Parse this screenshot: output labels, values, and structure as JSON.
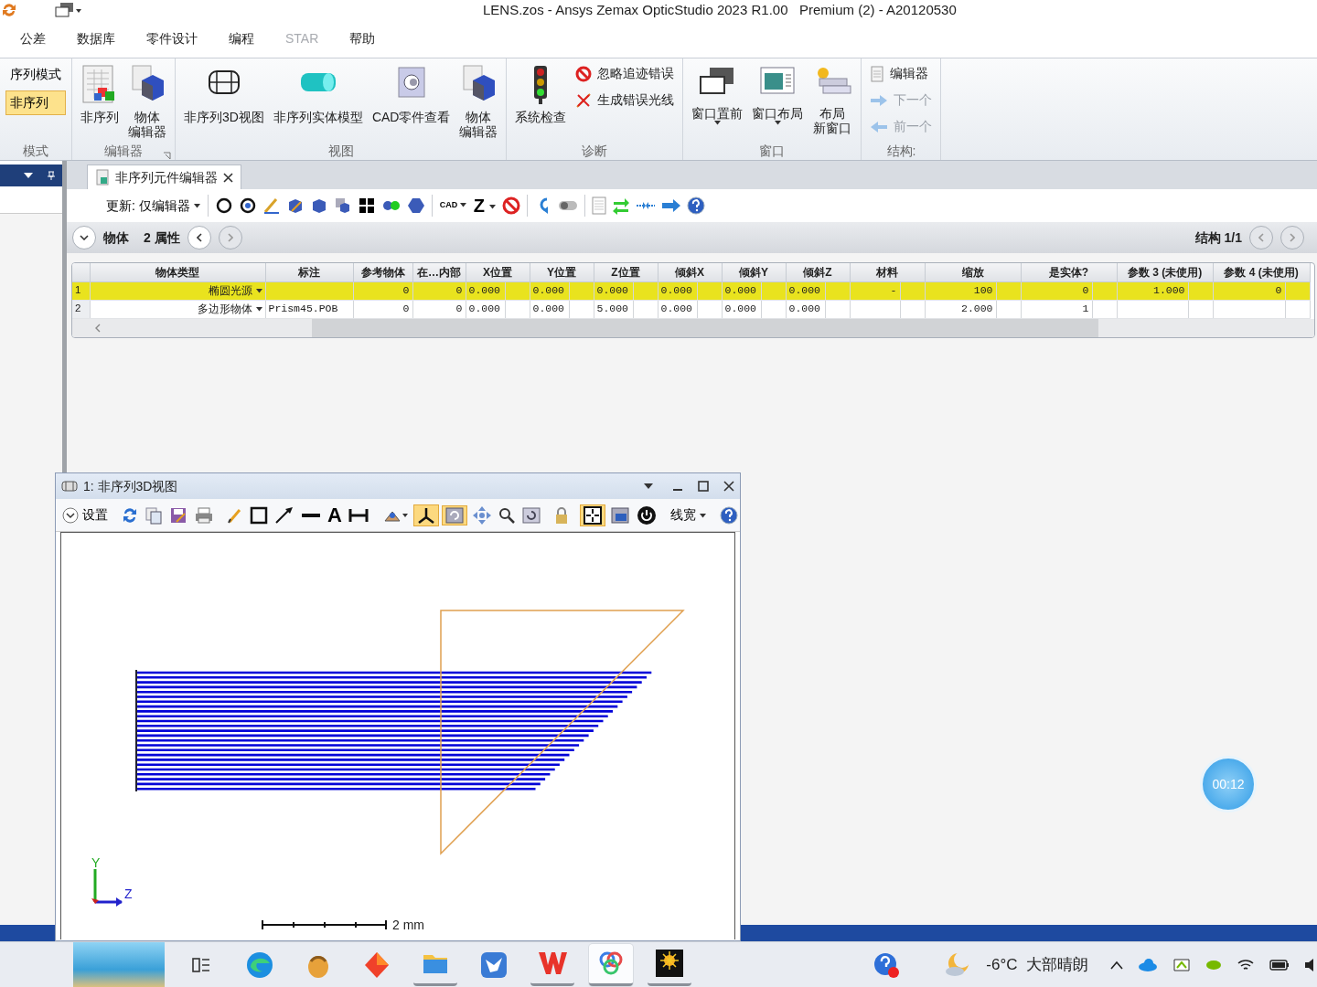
{
  "title_bar": {
    "title": "LENS.zos - Ansys Zemax OpticStudio 2023 R1.00   Premium (2) - A20120530"
  },
  "menu_tabs": [
    {
      "label": "公差",
      "disabled": false
    },
    {
      "label": "数据库",
      "disabled": false
    },
    {
      "label": "零件设计",
      "disabled": false
    },
    {
      "label": "编程",
      "disabled": false
    },
    {
      "label": "STAR",
      "disabled": true
    },
    {
      "label": "帮助",
      "disabled": false
    }
  ],
  "ribbon": {
    "groups": [
      {
        "title": "模式",
        "items": [
          {
            "kind": "option",
            "lines": [
              "序列模式"
            ],
            "selected": false
          },
          {
            "kind": "option",
            "lines": [
              "非序列"
            ],
            "selected": true
          }
        ]
      },
      {
        "title": "编辑器",
        "launcher": true,
        "items": [
          {
            "kind": "large",
            "lines": [
              "非序列"
            ]
          },
          {
            "kind": "large",
            "lines": [
              "物体",
              "编辑器"
            ]
          }
        ]
      },
      {
        "title": "视图",
        "items": [
          {
            "kind": "large",
            "lines": [
              "非序列3D视图"
            ]
          },
          {
            "kind": "large",
            "lines": [
              "非序列实体模型"
            ]
          },
          {
            "kind": "large",
            "lines": [
              "CAD零件查看"
            ]
          },
          {
            "kind": "large",
            "lines": [
              "物体",
              "编辑器"
            ]
          }
        ]
      },
      {
        "title": "诊断",
        "items": [
          {
            "kind": "large",
            "lines": [
              "系统检查"
            ]
          },
          {
            "kind": "small",
            "lines": [
              "忽略追迹错误"
            ],
            "disabled": false
          },
          {
            "kind": "small",
            "lines": [
              "生成错误光线"
            ],
            "disabled": false
          }
        ]
      },
      {
        "title": "窗口",
        "items": [
          {
            "kind": "large",
            "lines": [
              "窗口置前"
            ],
            "dropdown": true
          },
          {
            "kind": "large",
            "lines": [
              "窗口布局"
            ],
            "dropdown": true
          },
          {
            "kind": "large",
            "lines": [
              "布局",
              "新窗口"
            ]
          }
        ]
      },
      {
        "title": "结构:",
        "items": [
          {
            "kind": "small",
            "lines": [
              "编辑器"
            ],
            "disabled": false
          },
          {
            "kind": "small",
            "lines": [
              "下一个"
            ],
            "disabled": true
          },
          {
            "kind": "small",
            "lines": [
              "前一个"
            ],
            "disabled": true
          }
        ]
      }
    ]
  },
  "editor": {
    "tab": "非序列元件编辑器",
    "toolbar": [
      {
        "kind": "dropdown",
        "label": "更新: 仅编辑器"
      },
      {
        "kind": "separator"
      },
      {
        "kind": "icon"
      },
      {
        "kind": "icon"
      },
      {
        "kind": "icon"
      },
      {
        "kind": "icon"
      },
      {
        "kind": "icon"
      },
      {
        "kind": "icon"
      },
      {
        "kind": "icon"
      },
      {
        "kind": "icon"
      },
      {
        "kind": "icon"
      },
      {
        "kind": "separator"
      },
      {
        "kind": "dropdown",
        "label": "CAD"
      },
      {
        "kind": "dropdown",
        "label": "Z"
      },
      {
        "kind": "icon"
      },
      {
        "kind": "separator"
      },
      {
        "kind": "icon"
      },
      {
        "kind": "icon"
      },
      {
        "kind": "separator"
      },
      {
        "kind": "icon"
      },
      {
        "kind": "icon"
      },
      {
        "kind": "icon"
      },
      {
        "kind": "icon"
      },
      {
        "kind": "icon"
      }
    ],
    "object_label": "物体",
    "properties_label": "2 属性",
    "config_label": "结构 1/1",
    "columns": [
      {
        "label": "物体类型"
      },
      {
        "label": "标注"
      },
      {
        "label": "参考物体"
      },
      {
        "label": "在…内部"
      },
      {
        "label": "X位置"
      },
      {
        "label": "Y位置"
      },
      {
        "label": "Z位置"
      },
      {
        "label": "倾斜X"
      },
      {
        "label": "倾斜Y"
      },
      {
        "label": "倾斜Z"
      },
      {
        "label": "材料"
      },
      {
        "label": "缩放"
      },
      {
        "label": "是实体?"
      },
      {
        "label": "参数  3 (未使用)"
      },
      {
        "label": "参数  4 (未使用)"
      }
    ],
    "rows": [
      {
        "number": "1",
        "selected": true,
        "cells": [
          "椭圆光源",
          null,
          "0",
          "0",
          "0.000",
          "0.000",
          "0.000",
          "0.000",
          "0.000",
          "0.000",
          "-",
          "100",
          "0",
          "1.000",
          "0"
        ]
      },
      {
        "number": "2",
        "selected": false,
        "cells": [
          "多边形物体",
          "Prism45.POB",
          "0",
          "0",
          "0.000",
          "0.000",
          "5.000",
          "0.000",
          "0.000",
          "0.000",
          null,
          "2.000",
          "1",
          null,
          null
        ]
      }
    ]
  },
  "view_window": {
    "title": "1: 非序列3D视图",
    "toolbar": [
      {
        "kind": "menu",
        "label": "设置"
      },
      {
        "kind": "separator"
      },
      {
        "kind": "icon",
        "active": false
      },
      {
        "kind": "icon",
        "active": false
      },
      {
        "kind": "icon",
        "active": false
      },
      {
        "kind": "icon",
        "active": false
      },
      {
        "kind": "separator"
      },
      {
        "kind": "icon",
        "active": false
      },
      {
        "kind": "icon",
        "active": false
      },
      {
        "kind": "icon",
        "active": false
      },
      {
        "kind": "icon",
        "active": false
      },
      {
        "kind": "glyph",
        "label": "A"
      },
      {
        "kind": "icon",
        "active": false
      },
      {
        "kind": "separator"
      },
      {
        "kind": "icon",
        "active": false
      },
      {
        "kind": "icon",
        "active": true
      },
      {
        "kind": "icon",
        "active": true
      },
      {
        "kind": "icon",
        "active": false
      },
      {
        "kind": "icon",
        "active": false
      },
      {
        "kind": "icon",
        "active": false
      },
      {
        "kind": "separator"
      },
      {
        "kind": "icon",
        "active": false
      },
      {
        "kind": "separator"
      },
      {
        "kind": "icon",
        "active": true
      },
      {
        "kind": "icon",
        "active": false
      },
      {
        "kind": "icon",
        "active": false
      },
      {
        "kind": "separator"
      },
      {
        "kind": "dropdown",
        "label": "线宽"
      },
      {
        "kind": "separator"
      },
      {
        "kind": "icon",
        "active": false
      }
    ],
    "axis_labels": [
      "Y",
      "Z"
    ],
    "scale_label": "2 mm"
  },
  "timer": "00:12",
  "taskbar": {
    "apps": [
      {
        "running": false,
        "selected": false
      },
      {
        "running": false,
        "selected": false
      },
      {
        "running": false,
        "selected": false
      },
      {
        "running": false,
        "selected": false
      },
      {
        "running": true,
        "selected": false
      },
      {
        "running": false,
        "selected": false
      },
      {
        "running": true,
        "selected": false
      },
      {
        "running": true,
        "selected": true
      },
      {
        "running": true,
        "selected": false
      }
    ],
    "weather": "-6°C  大部晴朗"
  }
}
